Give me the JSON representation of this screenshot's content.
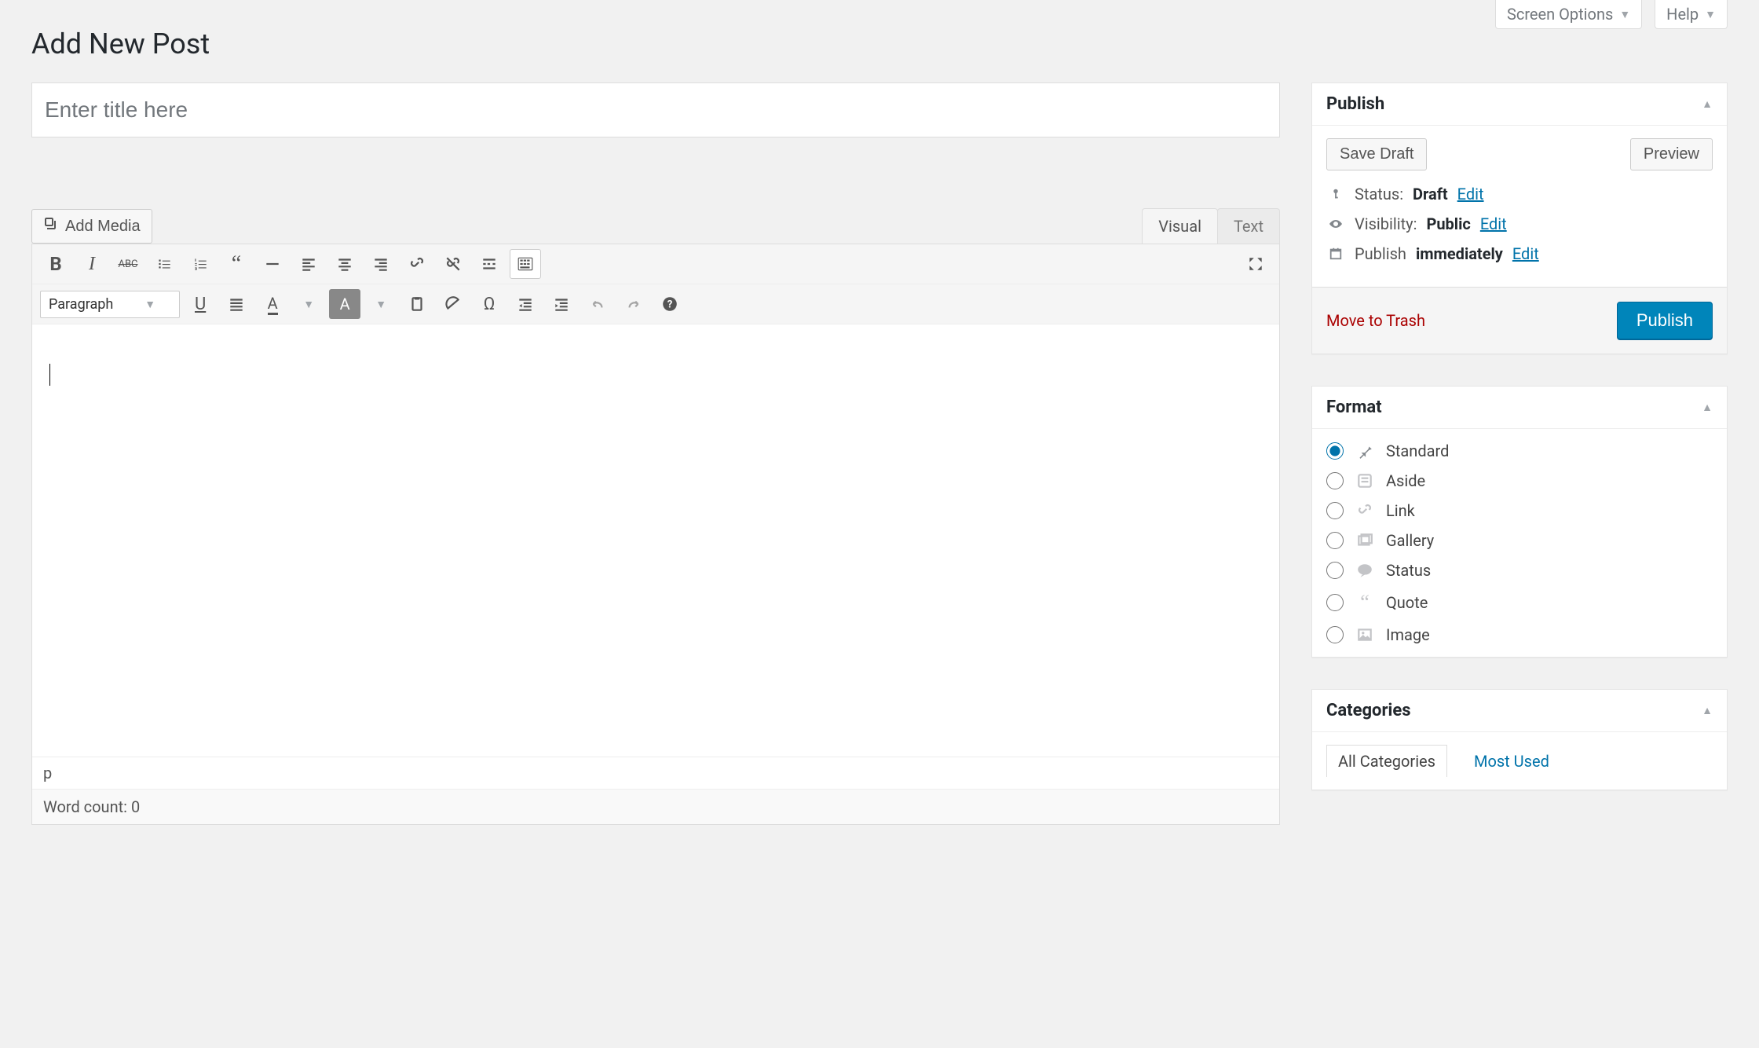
{
  "top": {
    "screen_options": "Screen Options",
    "help": "Help"
  },
  "page_title": "Add New Post",
  "title_placeholder": "Enter title here",
  "media_button": "Add Media",
  "editor_tabs": {
    "visual": "Visual",
    "text": "Text"
  },
  "paragraph_select": "Paragraph",
  "path_bar": "p",
  "word_count_label": "Word count: 0",
  "publish": {
    "heading": "Publish",
    "save_draft": "Save Draft",
    "preview": "Preview",
    "status_label": "Status:",
    "status_value": "Draft",
    "visibility_label": "Visibility:",
    "visibility_value": "Public",
    "publish_label": "Publish",
    "publish_value": "immediately",
    "edit": "Edit",
    "move_to_trash": "Move to Trash",
    "publish_button": "Publish"
  },
  "format": {
    "heading": "Format",
    "options": {
      "standard": "Standard",
      "aside": "Aside",
      "link": "Link",
      "gallery": "Gallery",
      "status": "Status",
      "quote": "Quote",
      "image": "Image"
    }
  },
  "categories": {
    "heading": "Categories",
    "all": "All Categories",
    "most_used": "Most Used"
  }
}
